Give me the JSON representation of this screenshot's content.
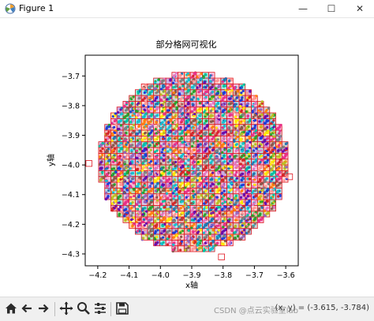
{
  "window": {
    "title": "Figure 1",
    "minimize_glyph": "—",
    "maximize_glyph": "☐",
    "close_glyph": "✕"
  },
  "chart_data": {
    "type": "scatter",
    "title": "部分格网可视化",
    "xlabel": "x轴",
    "ylabel": "y轴",
    "xlim": [
      -4.24,
      -3.56
    ],
    "ylim": [
      -4.34,
      -3.63
    ],
    "xticks": [
      -4.2,
      -4.1,
      -4.0,
      -3.9,
      -3.8,
      -3.7,
      -3.6
    ],
    "xtick_labels": [
      "−4.2",
      "−4.1",
      "−4.0",
      "−3.9",
      "−3.8",
      "−3.7",
      "−3.6"
    ],
    "yticks": [
      -3.7,
      -3.8,
      -3.9,
      -4.0,
      -4.1,
      -4.2,
      -4.3
    ],
    "ytick_labels": [
      "−3.7",
      "−3.8",
      "−3.9",
      "−4.0",
      "−4.1",
      "−4.2",
      "−4.3"
    ],
    "grid": {
      "cell_size": 0.0195,
      "center": [
        -3.895,
        -3.99
      ],
      "radius": 0.3,
      "edge_color": "#e0141e"
    },
    "point_colors": [
      "#1f3cd8",
      "#e8318a",
      "#2ca02c",
      "#ff7f0e",
      "#9467bd",
      "#17becf",
      "#d62728",
      "#8c564b",
      "#bcbd22",
      "#7f7f7f",
      "#ff9896",
      "#ffe600",
      "#00c0a0",
      "#e377c2",
      "#1f77b4",
      "#6a0dad"
    ],
    "grid_line": false,
    "legend": "none"
  },
  "toolbar": {
    "buttons": [
      "home-icon",
      "back-icon",
      "forward-icon",
      "pan-icon",
      "zoom-icon",
      "configure-icon",
      "save-icon"
    ],
    "coords_text": "(x, y) = (-3.615, -3.784)",
    "watermark": "CSDN @点云实验室lab"
  }
}
